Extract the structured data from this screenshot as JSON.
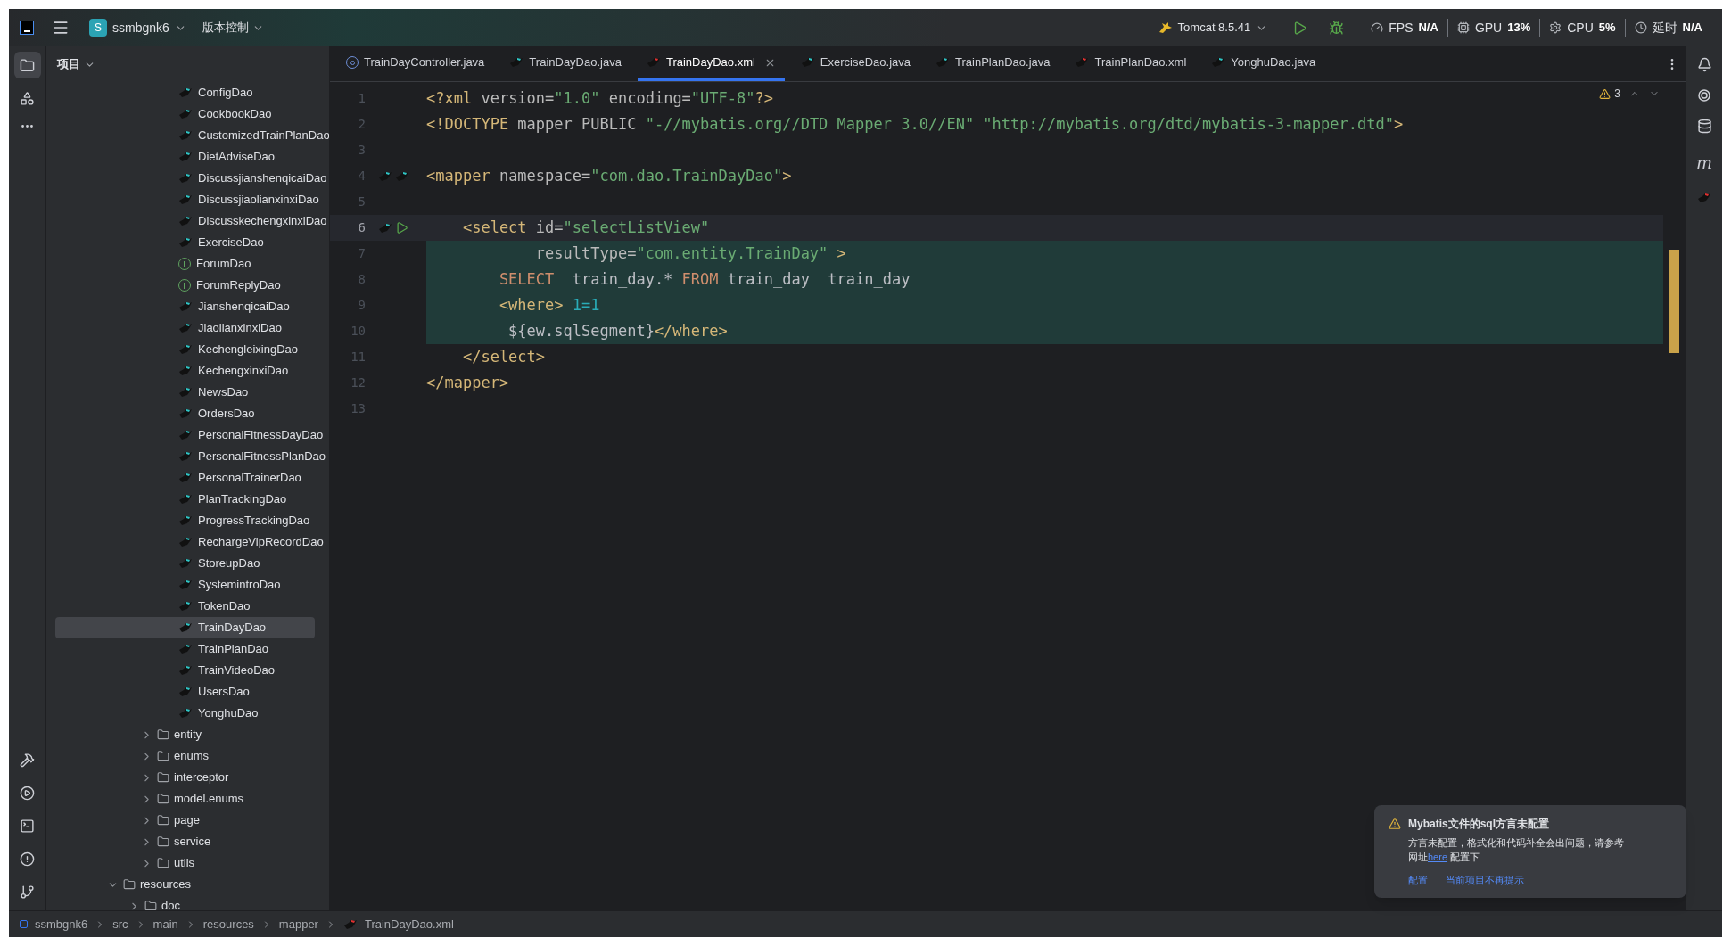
{
  "title_bar": {
    "project_badge": "S",
    "project": "ssmbgnk6",
    "vcs": "版本控制",
    "run_config": "Tomcat 8.5.41",
    "stats": [
      {
        "label": "FPS",
        "value": "N/A"
      },
      {
        "label": "GPU",
        "value": "13%"
      },
      {
        "label": "CPU",
        "value": "5%"
      },
      {
        "label": "延时",
        "value": "N/A"
      }
    ]
  },
  "project_panel": {
    "title": "项目",
    "dao_items": [
      {
        "label": "ConfigDao",
        "kind": "mapper",
        "selected": false
      },
      {
        "label": "CookbookDao",
        "kind": "mapper",
        "selected": false
      },
      {
        "label": "CustomizedTrainPlanDao",
        "kind": "mapper",
        "selected": false
      },
      {
        "label": "DietAdviseDao",
        "kind": "mapper",
        "selected": false
      },
      {
        "label": "DiscussjianshenqicaiDao",
        "kind": "mapper",
        "selected": false
      },
      {
        "label": "DiscussjiaolianxinxiDao",
        "kind": "mapper",
        "selected": false
      },
      {
        "label": "DiscusskechengxinxiDao",
        "kind": "mapper",
        "selected": false
      },
      {
        "label": "ExerciseDao",
        "kind": "mapper",
        "selected": false
      },
      {
        "label": "ForumDao",
        "kind": "interface",
        "selected": false
      },
      {
        "label": "ForumReplyDao",
        "kind": "interface",
        "selected": false
      },
      {
        "label": "JianshenqicaiDao",
        "kind": "mapper",
        "selected": false
      },
      {
        "label": "JiaolianxinxiDao",
        "kind": "mapper",
        "selected": false
      },
      {
        "label": "KechengleixingDao",
        "kind": "mapper",
        "selected": false
      },
      {
        "label": "KechengxinxiDao",
        "kind": "mapper",
        "selected": false
      },
      {
        "label": "NewsDao",
        "kind": "mapper",
        "selected": false
      },
      {
        "label": "OrdersDao",
        "kind": "mapper",
        "selected": false
      },
      {
        "label": "PersonalFitnessDayDao",
        "kind": "mapper",
        "selected": false
      },
      {
        "label": "PersonalFitnessPlanDao",
        "kind": "mapper",
        "selected": false
      },
      {
        "label": "PersonalTrainerDao",
        "kind": "mapper",
        "selected": false
      },
      {
        "label": "PlanTrackingDao",
        "kind": "mapper",
        "selected": false
      },
      {
        "label": "ProgressTrackingDao",
        "kind": "mapper",
        "selected": false
      },
      {
        "label": "RechargeVipRecordDao",
        "kind": "mapper",
        "selected": false
      },
      {
        "label": "StoreupDao",
        "kind": "mapper",
        "selected": false
      },
      {
        "label": "SystemintroDao",
        "kind": "mapper",
        "selected": false
      },
      {
        "label": "TokenDao",
        "kind": "mapper",
        "selected": false
      },
      {
        "label": "TrainDayDao",
        "kind": "mapper",
        "selected": true
      },
      {
        "label": "TrainPlanDao",
        "kind": "mapper",
        "selected": false
      },
      {
        "label": "TrainVideoDao",
        "kind": "mapper",
        "selected": false
      },
      {
        "label": "UsersDao",
        "kind": "mapper",
        "selected": false
      },
      {
        "label": "YonghuDao",
        "kind": "mapper",
        "selected": false
      }
    ],
    "packages": [
      {
        "label": "entity",
        "expanded": false
      },
      {
        "label": "enums",
        "expanded": false
      },
      {
        "label": "interceptor",
        "expanded": false
      },
      {
        "label": "model.enums",
        "expanded": false
      },
      {
        "label": "page",
        "expanded": false
      },
      {
        "label": "service",
        "expanded": false
      },
      {
        "label": "utils",
        "expanded": false
      }
    ],
    "roots": [
      {
        "label": "resources",
        "expanded": true,
        "children": [
          {
            "label": "doc",
            "expanded": false
          }
        ]
      }
    ]
  },
  "tabs": [
    {
      "label": "TrainDayController.java",
      "kind": "class",
      "selected": false
    },
    {
      "label": "TrainDayDao.java",
      "kind": "mapper-java",
      "selected": false
    },
    {
      "label": "TrainDayDao.xml",
      "kind": "mapper-xml",
      "selected": true
    },
    {
      "label": "ExerciseDao.java",
      "kind": "mapper-java",
      "selected": false
    },
    {
      "label": "TrainPlanDao.java",
      "kind": "mapper-java",
      "selected": false
    },
    {
      "label": "TrainPlanDao.xml",
      "kind": "mapper-xml",
      "selected": false
    },
    {
      "label": "YonghuDao.java",
      "kind": "mapper-java",
      "selected": false
    }
  ],
  "editor": {
    "warning_count": "3",
    "lines": [
      {
        "number": "1",
        "highlighted": false,
        "tokens": [
          {
            "text": "<?xml ",
            "kind": "tag"
          },
          {
            "text": "version=",
            "kind": "attr"
          },
          {
            "text": "\"1.0\" ",
            "kind": "string"
          },
          {
            "text": "encoding=",
            "kind": "attr"
          },
          {
            "text": "\"UTF-8\"",
            "kind": "string"
          },
          {
            "text": "?>",
            "kind": "tag"
          }
        ]
      },
      {
        "number": "2",
        "highlighted": false,
        "tokens": [
          {
            "text": "<!DOCTYPE ",
            "kind": "tag"
          },
          {
            "text": "mapper PUBLIC ",
            "kind": "attr"
          },
          {
            "text": "\"-//mybatis.org//DTD Mapper 3.0//EN\" \"http://mybatis.org/dtd/mybatis-3-mapper.dtd\"",
            "kind": "string"
          },
          {
            "text": ">",
            "kind": "tag"
          }
        ]
      },
      {
        "number": "3",
        "highlighted": false
      },
      {
        "number": "4",
        "highlighted": false,
        "gutter_icons": [
          {
            "kind": "mapper"
          },
          {
            "kind": "mapper"
          }
        ],
        "tokens": [
          {
            "text": "<mapper ",
            "kind": "tag"
          },
          {
            "text": "namespace=",
            "kind": "attr"
          },
          {
            "text": "\"com.dao.TrainDayDao\"",
            "kind": "string"
          },
          {
            "text": ">",
            "kind": "tag"
          }
        ]
      },
      {
        "number": "5",
        "highlighted": false
      },
      {
        "number": "6",
        "highlighted": false,
        "current": true,
        "gutter_icons": [
          {
            "kind": "mapper"
          },
          {
            "kind": "run"
          }
        ],
        "tokens": [
          {
            "text": "    <select ",
            "kind": "tag"
          },
          {
            "text": "id=",
            "kind": "attr"
          },
          {
            "text": "\"selectListView\"",
            "kind": "string"
          }
        ]
      },
      {
        "number": "7",
        "highlighted": true,
        "tokens": [
          {
            "text": "            resultType=",
            "kind": "attr"
          },
          {
            "text": "\"com.entity.TrainDay\" ",
            "kind": "string"
          },
          {
            "text": ">",
            "kind": "tag"
          }
        ]
      },
      {
        "number": "8",
        "highlighted": true,
        "tokens": [
          {
            "text": "        SELECT",
            "kind": "keyword"
          },
          {
            "text": "  train_day.* ",
            "kind": "plain"
          },
          {
            "text": "FROM",
            "kind": "keyword"
          },
          {
            "text": " train_day  train_day",
            "kind": "plain"
          }
        ]
      },
      {
        "number": "9",
        "highlighted": true,
        "tokens": [
          {
            "text": "        <where>",
            "kind": "tag"
          },
          {
            "text": " 1=1",
            "kind": "number"
          }
        ]
      },
      {
        "number": "10",
        "highlighted": true,
        "tokens": [
          {
            "text": "         ${ew.sqlSegment}",
            "kind": "plain"
          },
          {
            "text": "</where>",
            "kind": "tag"
          }
        ]
      },
      {
        "number": "11",
        "highlighted": false,
        "tokens": [
          {
            "text": "    </select>",
            "kind": "tag"
          }
        ]
      },
      {
        "number": "12",
        "highlighted": false,
        "tokens": [
          {
            "text": "</mapper>",
            "kind": "tag"
          }
        ]
      },
      {
        "number": "13",
        "highlighted": false
      }
    ]
  },
  "right_toolbar": {
    "maven_label": "m"
  },
  "notification": {
    "title": "Mybatis文件的sql方言未配置",
    "body": "方言未配置，格式化和代码补全会出问题，请参考",
    "body2": "网址",
    "link": "here",
    "body3": " 配置下",
    "actions": [
      "配置",
      "当前项目不再提示"
    ]
  },
  "breadcrumb": [
    "ssmbgnk6",
    "src",
    "main",
    "resources",
    "mapper",
    "TrainDayDao.xml"
  ]
}
